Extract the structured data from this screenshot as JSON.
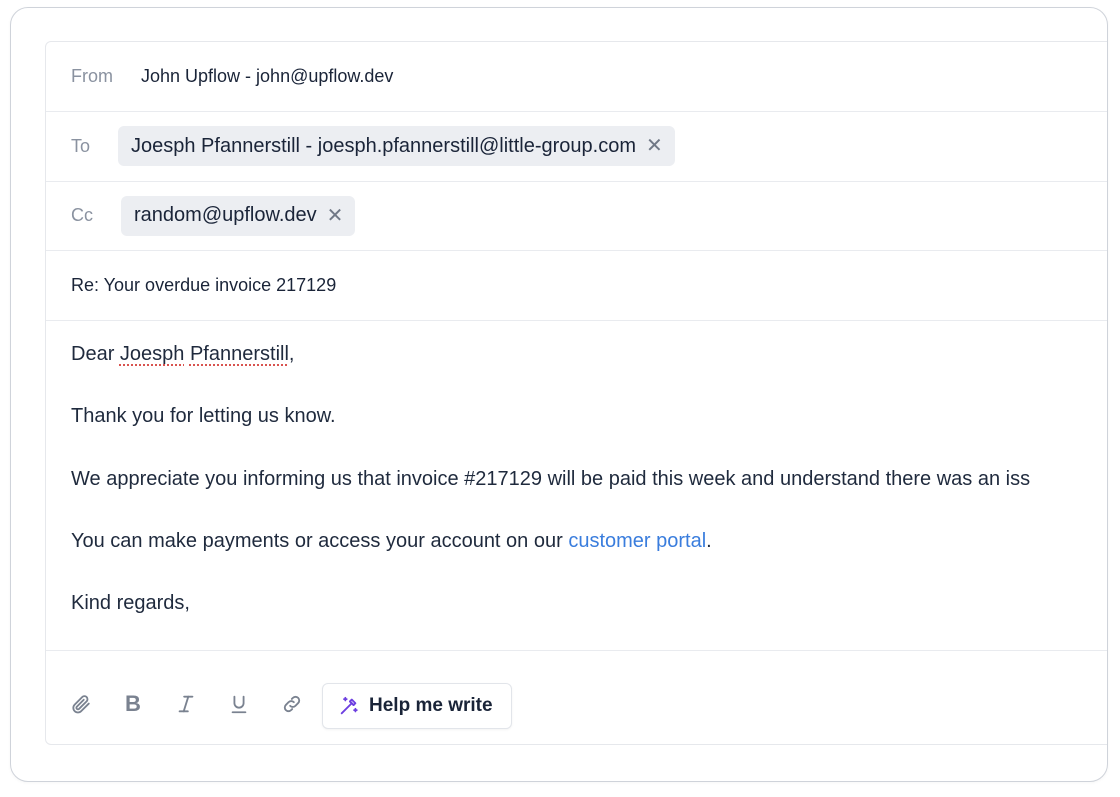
{
  "header": {
    "from_label": "From",
    "from_value": "John Upflow - john@upflow.dev",
    "to_label": "To",
    "to_recipient": "Joesph Pfannerstill - joesph.pfannerstill@little-group.com",
    "cc_label": "Cc",
    "cc_recipient": "random@upflow.dev",
    "remove_glyph": "✕",
    "subject": "Re: Your overdue invoice 217129"
  },
  "body": {
    "greeting_prefix": "Dear ",
    "greeting_first": "Joesph",
    "greeting_space": " ",
    "greeting_last": "Pfannerstill",
    "greeting_suffix": ",",
    "line1": "Thank you for letting us know.",
    "line2": "We appreciate you informing us that invoice #217129 will be paid this week and understand there was an iss",
    "line3_prefix": "You can make payments or access your account on our ",
    "line3_link": "customer portal",
    "line3_suffix": ".",
    "closing": "Kind regards,"
  },
  "toolbar": {
    "bold_glyph": "B",
    "help_label": "Help me write",
    "icons": [
      "paperclip-icon",
      "bold-icon",
      "italic-icon",
      "underline-icon",
      "link-icon",
      "magic-wand-icon"
    ],
    "accent_color": "#6d3fe0"
  }
}
